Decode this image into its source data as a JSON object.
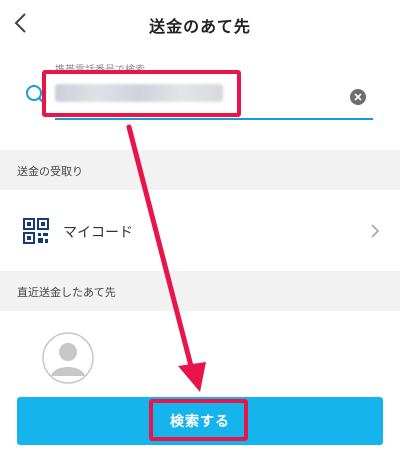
{
  "header": {
    "title": "送金のあて先",
    "back_icon": "chevron-left-icon"
  },
  "search": {
    "label": "携帯電話番号で検索",
    "value": "",
    "icon": "search-icon",
    "clear_icon": "close-icon"
  },
  "sections": {
    "receive": "送金の受取り",
    "recent": "直近送金したあて先"
  },
  "mycode": {
    "label": "マイコード",
    "icon": "qr-code-icon"
  },
  "recent": {
    "avatar_icon": "user-avatar-icon"
  },
  "search_button": {
    "label": "検索する"
  },
  "colors": {
    "accent": "#16b4ec",
    "underline": "#1a9ad6",
    "highlight": "#e8144a",
    "section_bg": "#f2f2f2"
  }
}
